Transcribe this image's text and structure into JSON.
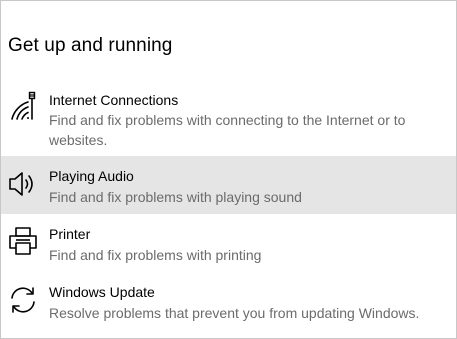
{
  "section": {
    "heading": "Get up and running"
  },
  "troubleshooters": [
    {
      "title": "Internet Connections",
      "description": "Find and fix problems with connecting to the Internet or to websites.",
      "icon": "network-wifi-icon"
    },
    {
      "title": "Playing Audio",
      "description": "Find and fix problems with playing sound",
      "icon": "speaker-icon",
      "selected": true
    },
    {
      "title": "Printer",
      "description": "Find and fix problems with printing",
      "icon": "printer-icon"
    },
    {
      "title": "Windows Update",
      "description": "Resolve problems that prevent you from updating Windows.",
      "icon": "sync-arrows-icon"
    }
  ],
  "colors": {
    "selected_background": "#e5e5e5",
    "description_text": "#6b6b6b",
    "title_text": "#000000"
  }
}
